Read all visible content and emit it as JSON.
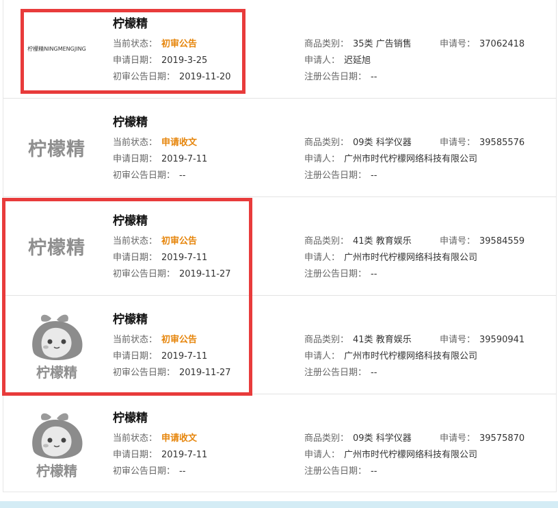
{
  "labels": {
    "status": "当前状态：",
    "apply_date": "申请日期：",
    "prelim_date": "初审公告日期：",
    "category": "商品类别：",
    "reg_no": "申请号：",
    "applicant": "申请人：",
    "reg_date": "注册公告日期："
  },
  "results": [
    {
      "name": "柠檬精",
      "logo_type": "small-text",
      "logo_text": "柠檬精NINGMENGJING",
      "status": "初审公告",
      "apply_date": "2019-3-25",
      "prelim_date": "2019-11-20",
      "category": "35类 广告销售",
      "reg_no": "37062418",
      "applicant": "迟延旭",
      "reg_date": "--"
    },
    {
      "name": "柠檬精",
      "logo_type": "text",
      "logo_text": "柠檬精",
      "status": "申请收文",
      "apply_date": "2019-7-11",
      "prelim_date": "--",
      "category": "09类 科学仪器",
      "reg_no": "39585576",
      "applicant": "广州市时代柠檬网络科技有限公司",
      "reg_date": "--"
    },
    {
      "name": "柠檬精",
      "logo_type": "text",
      "logo_text": "柠檬精",
      "status": "初审公告",
      "apply_date": "2019-7-11",
      "prelim_date": "2019-11-27",
      "category": "41类 教育娱乐",
      "reg_no": "39584559",
      "applicant": "广州市时代柠檬网络科技有限公司",
      "reg_date": "--"
    },
    {
      "name": "柠檬精",
      "logo_type": "character",
      "logo_text": "柠檬精",
      "status": "初审公告",
      "apply_date": "2019-7-11",
      "prelim_date": "2019-11-27",
      "category": "41类 教育娱乐",
      "reg_no": "39590941",
      "applicant": "广州市时代柠檬网络科技有限公司",
      "reg_date": "--"
    },
    {
      "name": "柠檬精",
      "logo_type": "character",
      "logo_text": "柠檬精",
      "status": "申请收文",
      "apply_date": "2019-7-11",
      "prelim_date": "--",
      "category": "09类 科学仪器",
      "reg_no": "39575870",
      "applicant": "广州市时代柠檬网络科技有限公司",
      "reg_date": "--"
    }
  ],
  "colors": {
    "status_text": "#e6850b",
    "highlight_box": "#e83b3b",
    "logo_gray": "#8e8e8e"
  }
}
